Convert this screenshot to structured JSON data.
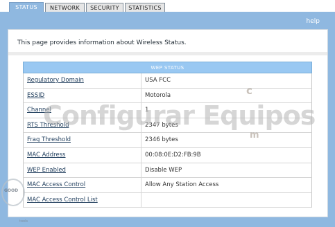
{
  "tabs": [
    {
      "label": "STATUS",
      "active": true
    },
    {
      "label": "NETWORK",
      "active": false
    },
    {
      "label": "SECURITY",
      "active": false
    },
    {
      "label": "STATISTICS",
      "active": false
    }
  ],
  "help_label": "help",
  "description": "This page provides information about Wireless Status.",
  "table": {
    "header": "WEP STATUS",
    "rows": [
      {
        "label": "Regulatory Domain",
        "value": "USA FCC"
      },
      {
        "label": "ESSID",
        "value": "Motorola"
      },
      {
        "label": "Channel",
        "value": "1"
      },
      {
        "label": "RTS Threshold",
        "value": "2347  bytes"
      },
      {
        "label": "Frag Threshold",
        "value": "2346  bytes"
      },
      {
        "label": "MAC Address",
        "value": "00:08:0E:D2:FB:9B"
      },
      {
        "label": "WEP Enabled",
        "value": "Disable WEP"
      },
      {
        "label": "MAC Access Control",
        "value": "Allow Any Station Access"
      },
      {
        "label": "MAC Access Control List",
        "value": ""
      }
    ]
  },
  "watermark": {
    "title": "Configurar Equipos",
    "mark_c": "c",
    "mark_m": "m",
    "seal_text": "GOOD",
    "seal_sub": "",
    "seal_sub2": "tools"
  },
  "colors": {
    "panel": "#8fb8e0",
    "tab_active": "#8fb8e0",
    "table_header": "#99c8f2",
    "link": "#1f3d5c"
  }
}
